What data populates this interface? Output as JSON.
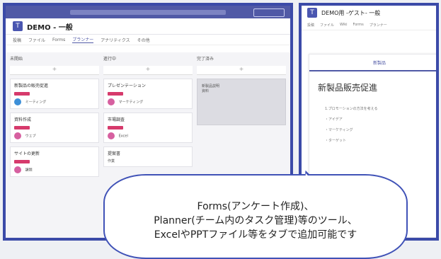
{
  "left_window": {
    "title": "DEMO - 一般",
    "tabs": [
      "投稿",
      "ファイル",
      "Forms",
      "プランナー",
      "アナリティクス",
      "その他"
    ],
    "columns": [
      {
        "name": "未開始",
        "cards": [
          {
            "title": "新製品の販売促進",
            "label": "ミーティング"
          },
          {
            "title": "資料作成",
            "label": "ウェブ"
          },
          {
            "title": "サイトの更新",
            "label": "課題"
          }
        ]
      },
      {
        "name": "進行中",
        "cards": [
          {
            "title": "プレゼンテーション",
            "label": "マーケティング"
          },
          {
            "title": "市場調査",
            "label": "Excel"
          },
          {
            "title": "提案書",
            "label": "作業"
          }
        ]
      },
      {
        "name": "完了済み",
        "cards": [
          {
            "title": "新製品説明",
            "label": "資料"
          }
        ]
      }
    ]
  },
  "right_window": {
    "title": "DEMO用 -ゲスト- 一般",
    "tabs": [
      "投稿",
      "ファイル",
      "Wiki",
      "Forms",
      "プランナー"
    ],
    "doc_bar": "新製品",
    "doc_title": "新製品販売促進",
    "bullets": [
      "1.プロモーションの方法を考える",
      "・アイデア",
      "・マーケティング",
      "・ターゲット"
    ]
  },
  "callout": {
    "line1": "Forms(アンケート作成)、",
    "line2": "Planner(チーム内のタスク管理)等のツール、",
    "line3": "ExcelやPPTファイル等をタブで追加可能です"
  }
}
